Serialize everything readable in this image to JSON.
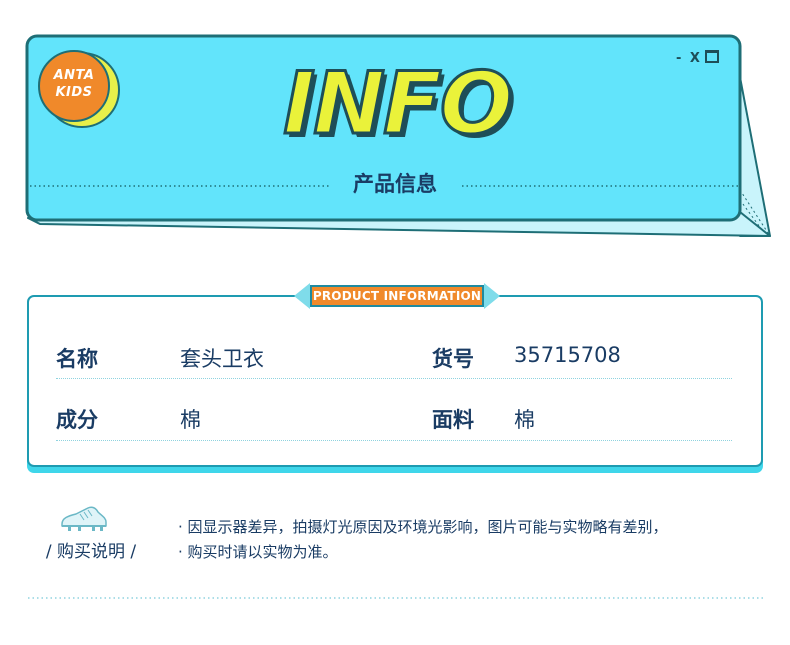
{
  "banner": {
    "logo_line1": "ANTA",
    "logo_line2": "KIDS",
    "window_controls": "- X",
    "title": "INFO",
    "subtitle": "产品信息"
  },
  "product_info": {
    "badge": "PRODUCT INFORMATION",
    "rows": [
      {
        "label_left": "名称",
        "value_left": "套头卫衣",
        "label_right": "货号",
        "value_right": "35715708"
      },
      {
        "label_left": "成分",
        "value_left": "棉",
        "label_right": "面料",
        "value_right": "棉"
      }
    ]
  },
  "purchase_notes": {
    "title": "/ 购买说明 /",
    "icon": "sneaker-icon",
    "lines": [
      "· 因显示器差异，拍摄灯光原因及环境光影响，图片可能与实物略有差别，",
      "· 购买时请以实物为准。"
    ]
  },
  "colors": {
    "banner_fill": "#62e4fb",
    "banner_border": "#1e6e76",
    "accent_orange": "#f0892a",
    "accent_yellow": "#eaf23a",
    "card_border": "#1e9bb1",
    "text_dark": "#1a3c64"
  }
}
